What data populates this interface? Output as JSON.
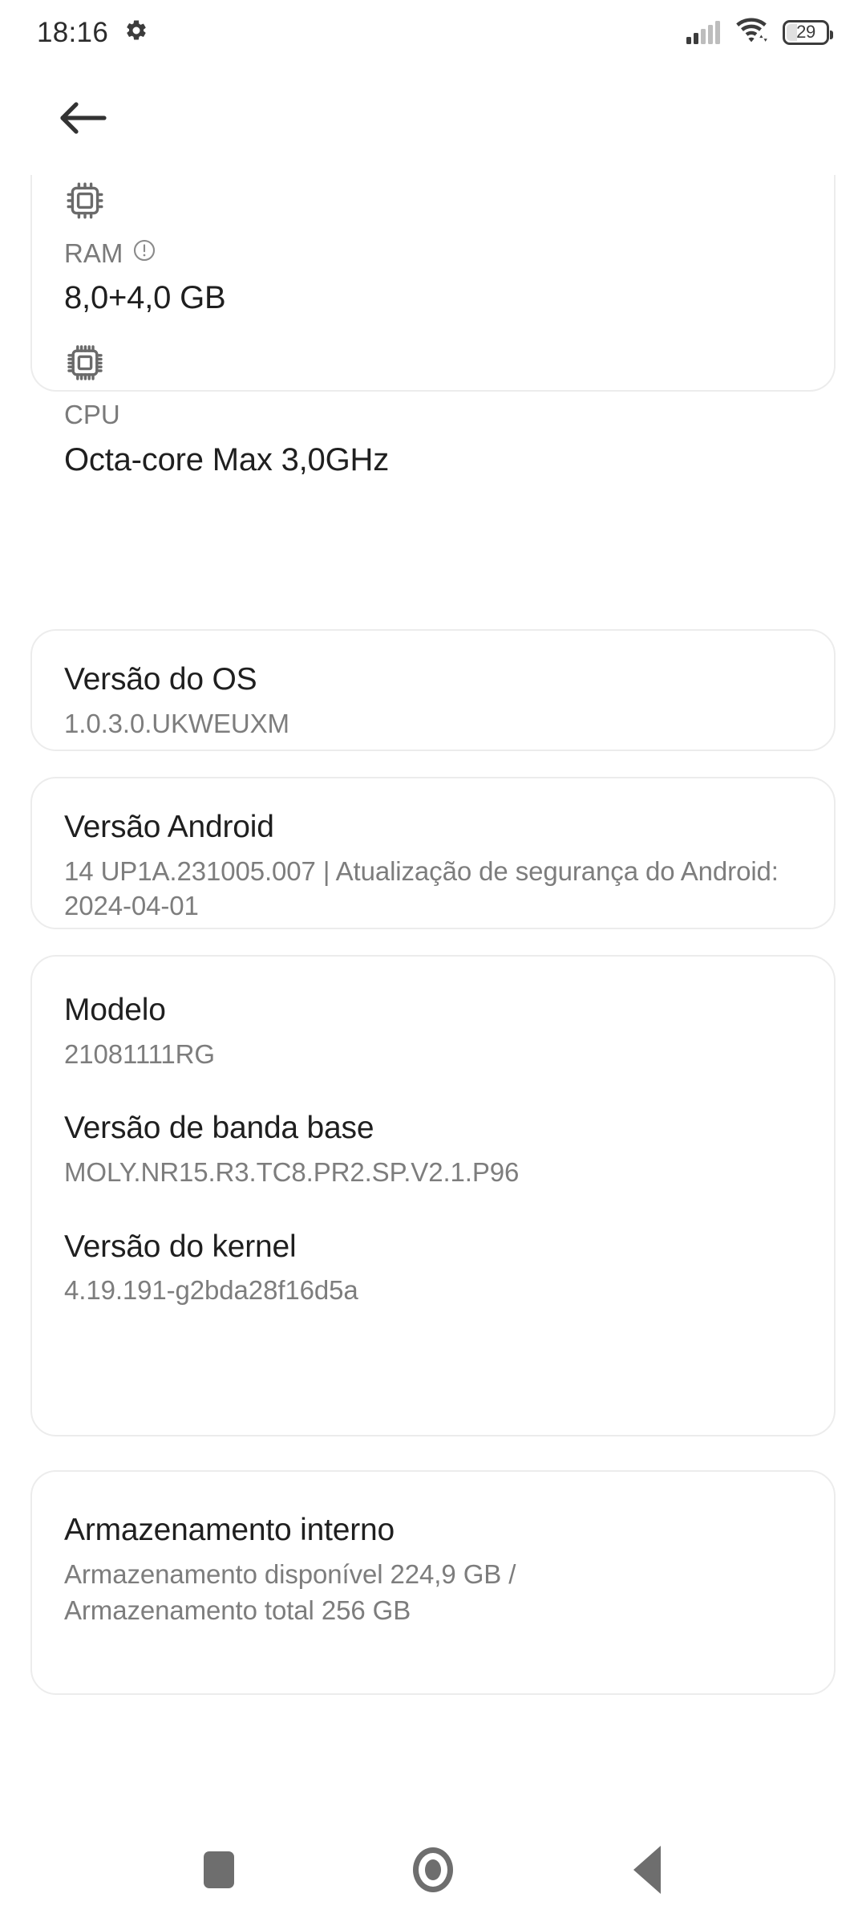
{
  "status_bar": {
    "clock": "18:16",
    "settings_icon": "gear-icon",
    "signal_icon": "signal-bars-icon",
    "signal_bars_total": 5,
    "signal_bars_active": 2,
    "wifi_icon": "wifi-icon",
    "battery_level": "29"
  },
  "header": {
    "back_icon": "arrow-left-icon"
  },
  "cards": {
    "hardware": {
      "ram": {
        "icon": "memory-chip-icon",
        "label": "RAM",
        "info_icon": "exclamation-circle-icon",
        "value": "8,0+4,0 GB"
      },
      "cpu": {
        "icon": "cpu-chip-icon",
        "label": "CPU",
        "value": "Octa-core Max 3,0GHz"
      }
    },
    "os_version": {
      "title": "Versão do OS",
      "value": "1.0.3.0.UKWEUXM"
    },
    "android_version": {
      "title": "Versão Android",
      "value": "14 UP1A.231005.007 | Atualização de segurança do Android: 2024-04-01"
    },
    "device": [
      {
        "title": "Modelo",
        "value": "21081111RG"
      },
      {
        "title": "Versão de banda base",
        "value": "MOLY.NR15.R3.TC8.PR2.SP.V2.1.P96"
      },
      {
        "title": "Versão do kernel",
        "value": "4.19.191-g2bda28f16d5a"
      }
    ],
    "storage": {
      "title": "Armazenamento interno",
      "line1": "Armazenamento disponível  224,9 GB /",
      "line2": "Armazenamento total  256 GB"
    }
  },
  "nav_bar": {
    "recents_icon": "recents-square-icon",
    "home_icon": "home-circle-icon",
    "back_icon": "back-triangle-icon"
  },
  "colors": {
    "background": "#ffffff",
    "card_border": "#ececec",
    "primary_text": "#1f1f1f",
    "secondary_text": "#7d7d7d",
    "nav_icon": "#6e6e6e"
  }
}
